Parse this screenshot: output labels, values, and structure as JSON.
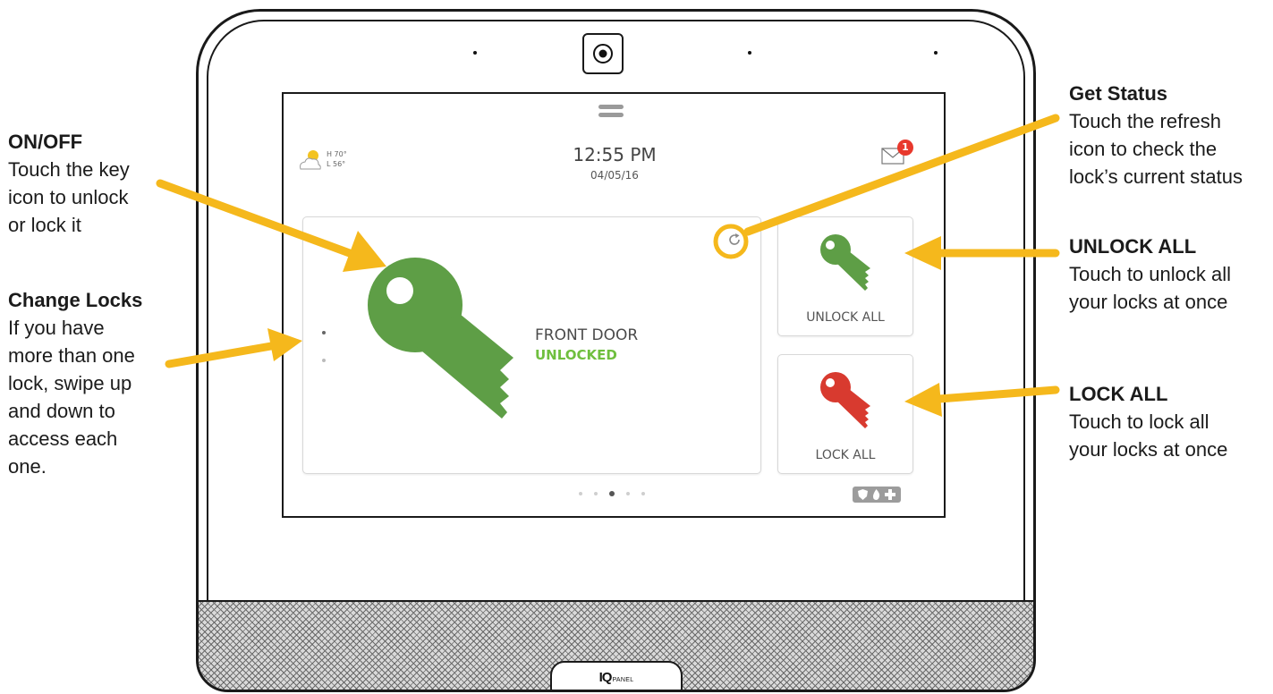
{
  "device": {
    "brand_logo": "IQ",
    "brand_sub": "PANEL"
  },
  "screen": {
    "weather": {
      "high": "H 70°",
      "low": "L 56°",
      "icon": "partly-cloudy-icon"
    },
    "time": "12:55 PM",
    "date": "04/05/16",
    "messages": {
      "icon": "envelope-icon",
      "unread_count": "1"
    },
    "lock_card": {
      "name": "FRONT DOOR",
      "status": "UNLOCKED",
      "status_color": "#6fbf3e",
      "key_color": "#5e9e46",
      "refresh_icon": "refresh-icon"
    },
    "unlock_all": {
      "label": "UNLOCK ALL",
      "key_color": "#5e9e46"
    },
    "lock_all": {
      "label": "LOCK ALL",
      "key_color": "#d83a2f"
    },
    "pager": {
      "pages": 5,
      "active_index": 2
    },
    "emergency_icons": [
      "shield-icon",
      "fire-icon",
      "medical-cross-icon"
    ]
  },
  "callouts": {
    "on_off": {
      "title": "ON/OFF",
      "desc": "Touch the key\nicon to unlock\nor lock it"
    },
    "change_locks": {
      "title": "Change Locks",
      "desc": "If you have\nmore than one\nlock, swipe up\nand down to\naccess each\none."
    },
    "get_status": {
      "title": "Get Status",
      "desc": "Touch the refresh\nicon to check the\nlock’s current status"
    },
    "unlock_all": {
      "title": "UNLOCK ALL",
      "desc": "Touch to unlock all\nyour locks at once"
    },
    "lock_all": {
      "title": "LOCK ALL",
      "desc": "Touch to lock all\nyour locks at once"
    }
  },
  "colors": {
    "arrow": "#f5b81c",
    "accent_green": "#6fbf3e",
    "badge_red": "#e8382c"
  }
}
